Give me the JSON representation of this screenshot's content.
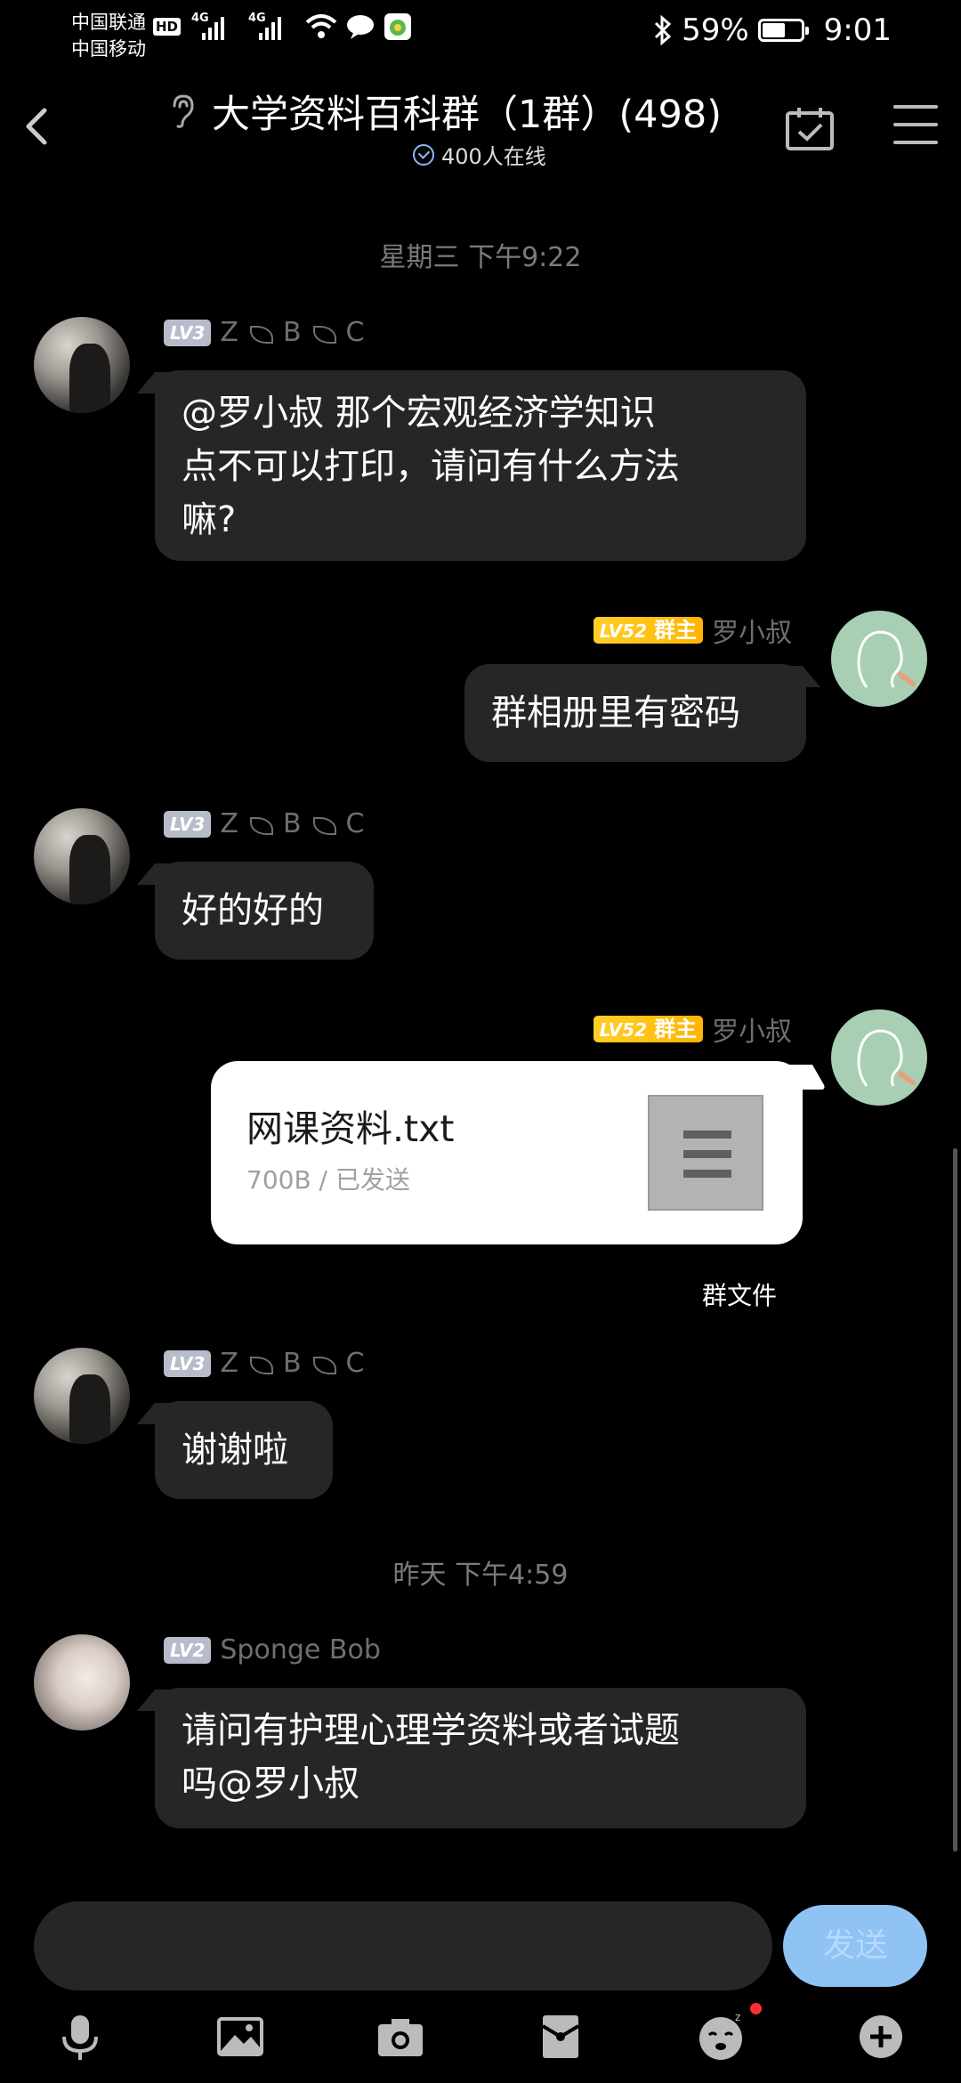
{
  "status_bar": {
    "carrier_1": "中国联通",
    "hd_badge": "HD",
    "carrier_2": "中国移动",
    "net_1": "4G",
    "net_2": "4G",
    "battery_percent": "59%",
    "battery_level": 0.59,
    "time": "9:01"
  },
  "header": {
    "title": "大学资料百科群（1群）(498)",
    "online_text": "400人在线"
  },
  "messages": {
    "ts1": "星期三 下午9:22",
    "ts2": "昨天 下午4:59",
    "m1": {
      "level": "LV3",
      "sender": "Z",
      "s2": "B",
      "s3": "C",
      "text_line1": "@罗小叔 那个宏观经济学知识",
      "text_line2": "点不可以打印，请问有什么方法",
      "text_line3": "嘛?"
    },
    "m2": {
      "level": "LV52",
      "role": "群主",
      "sender": "罗小叔",
      "text": "群相册里有密码"
    },
    "m3": {
      "level": "LV3",
      "sender": "Z",
      "s2": "B",
      "s3": "C",
      "text": "好的好的"
    },
    "m4": {
      "level": "LV52",
      "role": "群主",
      "sender": "罗小叔",
      "file_name": "网课资料.txt",
      "file_info": "700B / 已发送",
      "source": "群文件"
    },
    "m5": {
      "level": "LV3",
      "sender": "Z",
      "s2": "B",
      "s3": "C",
      "text": "谢谢啦"
    },
    "m6": {
      "level": "LV2",
      "sender": "Sponge Bob",
      "text_line1": "请问有护理心理学资料或者试题",
      "text_line2": "吗@罗小叔"
    }
  },
  "input": {
    "placeholder": "",
    "send_label": "发送"
  },
  "toolbar": {
    "icons": [
      "mic-icon",
      "image-icon",
      "camera-icon",
      "red-packet-icon",
      "emoji-icon",
      "plus-icon"
    ]
  },
  "colors": {
    "background": "#000000",
    "bubble": "#262626",
    "gold_badge": "#ffc21a",
    "send_button": "#8ec3f3",
    "notification_dot": "#ff2f2f"
  }
}
